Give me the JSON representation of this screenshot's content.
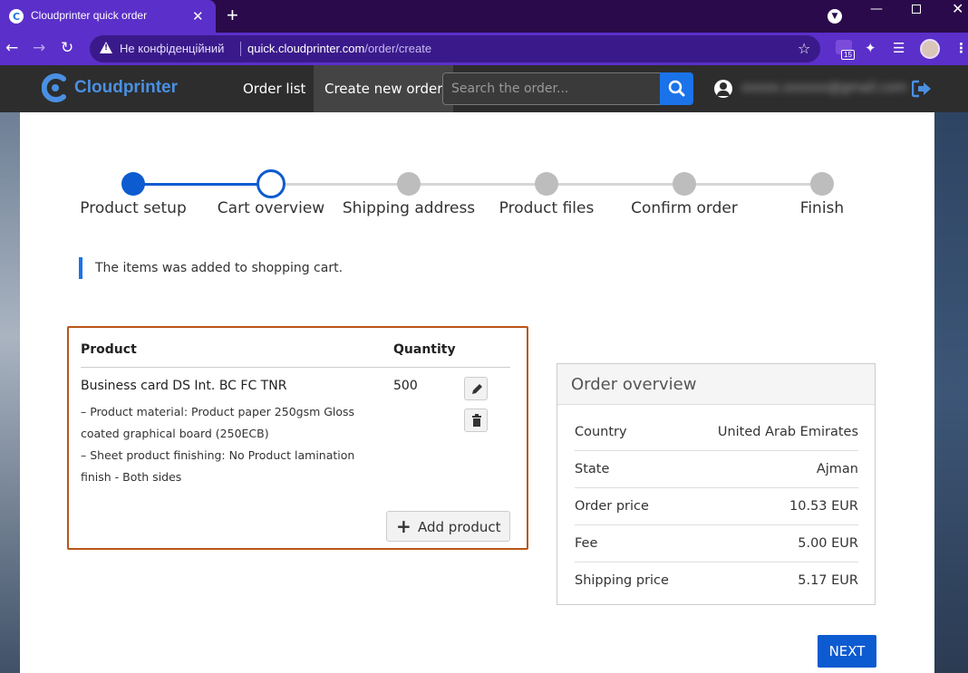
{
  "browser": {
    "tab_title": "Cloudprinter quick order",
    "close_glyph": "✕",
    "new_tab_glyph": "+",
    "security_label": "Не конфіденційний",
    "url_host": "quick.cloudprinter.com",
    "url_path": "/order/create",
    "extension_badge": "15"
  },
  "header": {
    "logo_text": "Cloudprinter",
    "nav": {
      "order_list": "Order list",
      "create_order": "Create new order"
    },
    "search_placeholder": "Search the order...",
    "user_email": "xxxxx.xxxxxx@gmail.com",
    "accent_color": "#1a73e8"
  },
  "stepper": {
    "steps": [
      {
        "label": "Product setup",
        "state": "done"
      },
      {
        "label": "Cart overview",
        "state": "current"
      },
      {
        "label": "Shipping address",
        "state": "todo"
      },
      {
        "label": "Product files",
        "state": "todo"
      },
      {
        "label": "Confirm order",
        "state": "todo"
      },
      {
        "label": "Finish",
        "state": "todo"
      }
    ]
  },
  "notice": "The items was added to shopping cart.",
  "cart": {
    "columns": {
      "product": "Product",
      "quantity": "Quantity"
    },
    "items": [
      {
        "name": "Business card DS Int. BC FC TNR",
        "details_line1": "– Product material: Product paper 250gsm Gloss",
        "details_line2": "coated graphical board (250ECB)",
        "details_line3": "– Sheet product finishing: No Product lamination",
        "details_line4": "finish - Both sides",
        "quantity": "500"
      }
    ],
    "add_button": "Add product"
  },
  "overview": {
    "title": "Order overview",
    "rows": [
      {
        "label": "Country",
        "value": "United Arab Emirates"
      },
      {
        "label": "State",
        "value": "Ajman"
      },
      {
        "label": "Order price",
        "value": "10.53 EUR"
      },
      {
        "label": "Fee",
        "value": "5.00 EUR"
      },
      {
        "label": "Shipping price",
        "value": "5.17 EUR"
      }
    ]
  },
  "next_button": "NEXT"
}
